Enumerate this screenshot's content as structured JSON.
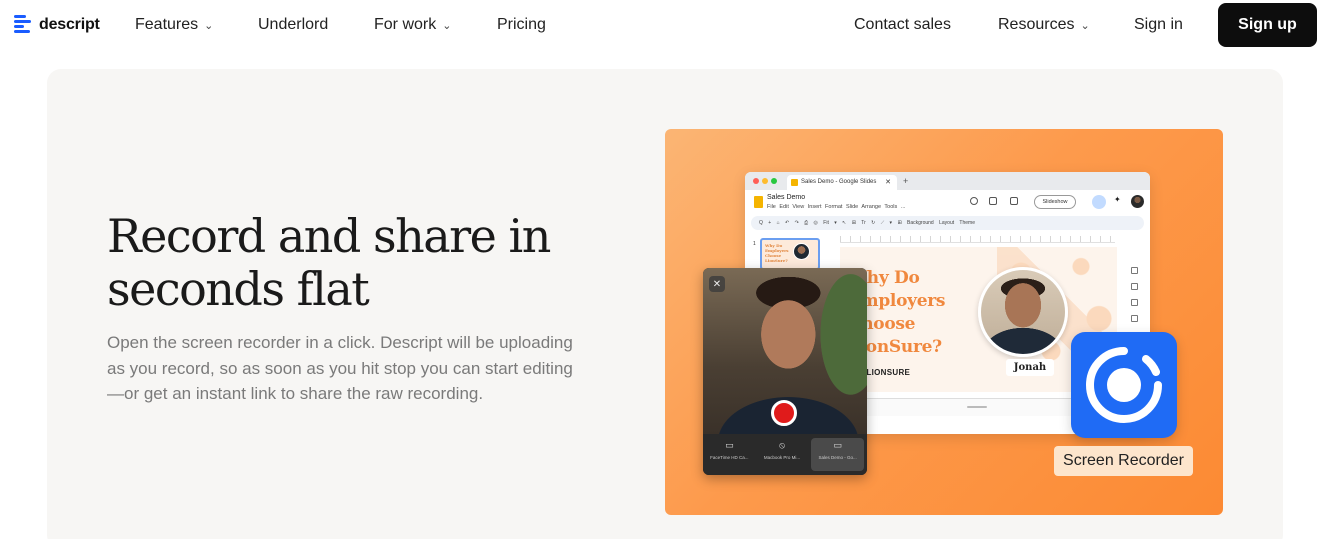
{
  "nav": {
    "brand": "descript",
    "left_items": [
      {
        "label": "Features",
        "has_dropdown": true
      },
      {
        "label": "Underlord",
        "has_dropdown": false
      },
      {
        "label": "For work",
        "has_dropdown": true
      },
      {
        "label": "Pricing",
        "has_dropdown": false
      }
    ],
    "right_items": [
      {
        "label": "Contact sales",
        "has_dropdown": false
      },
      {
        "label": "Resources",
        "has_dropdown": true
      },
      {
        "label": "Sign in",
        "has_dropdown": false
      }
    ],
    "signup_label": "Sign up",
    "chevron": "⌄"
  },
  "hero": {
    "headline": "Record and share in seconds flat",
    "subtext": "Open the screen recorder in a click. Descript will be uploading as you record, so as soon as you hit stop you can start editing—or get an instant link to share the raw recording."
  },
  "illustration": {
    "browser_tab": "Sales Demo - Google Slides",
    "doc_title": "Sales Demo",
    "doc_menu": "File Edit View Insert Format Slide Arrange Tools ...",
    "slideshow_label": "Slideshow",
    "toolbar_text": "Q + ⌂ ↶ ↷ ⎙ ◎ Fit ▾ ↖ ⊞ Tr ↻ ⟋ ▾ ⊞ Background Layout Theme",
    "thumb_number": "1",
    "thumb_text": "Why Do Employers Choose LionSure?",
    "slide_title_lines": [
      "Why Do",
      "Employers",
      "Choose",
      "LionSure?"
    ],
    "slide_brand": "LIONSURE",
    "person_label": "Jonah",
    "camera_options": [
      {
        "icon": "video-camera-icon",
        "label": "FaceTime HD Ca..."
      },
      {
        "icon": "microphone-icon",
        "label": "Macbook Pro Mi..."
      },
      {
        "icon": "monitor-icon",
        "label": "Sales Demo - Go..."
      }
    ],
    "close_glyph": "✕",
    "recorder_label": "Screen Recorder"
  },
  "colors": {
    "brand_blue": "#1a5cff",
    "signup_bg": "#0d0d0d",
    "hero_bg": "#f7f6f4",
    "art_orange": "#fd9a4c",
    "record_red": "#e01b1b",
    "recorder_blue": "#1f6bf5"
  }
}
